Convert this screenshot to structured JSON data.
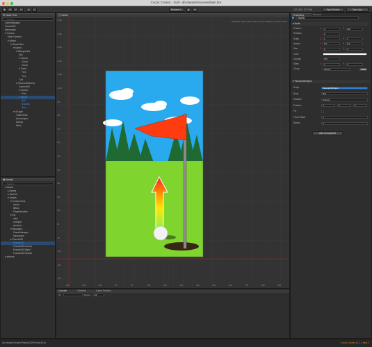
{
  "window": {
    "title": "Cocos Creator - Golf - db://assets/Scenes/Main.fire",
    "status_path": "db://assets/Scripts/Pseudo3D/Pseudo3D.ts",
    "version": "Cocos Creator v2.1.1-beta.2"
  },
  "toolbar": {
    "preview_mode": "Browser",
    "play_glyph": "▶",
    "refresh_glyph": "↻",
    "ip": "192.168.1.52:7456",
    "open_project": "Open Project",
    "open_app": "Open App"
  },
  "scene": {
    "tab": "Scene",
    "hint": "Drag with right mouse button to pan viewport, scroll to zoom"
  },
  "rulers": {
    "x": [
      "-350",
      "-250",
      "-150",
      "-50",
      "50",
      "150",
      "250",
      "350",
      "450",
      "550",
      "650",
      "750",
      "850",
      "950"
    ],
    "y": [
      "1,550",
      "1,450",
      "1,350",
      "1,250",
      "1,150",
      "1,050",
      "950",
      "850",
      "750",
      "650",
      "550",
      "450",
      "350",
      "250",
      "150",
      "50",
      "-50",
      "-150",
      "-250",
      "-350"
    ]
  },
  "hierarchy": {
    "tab": "Node Tree",
    "search": "Search...",
    "rows": [
      {
        "label": "GameManager",
        "d": 1
      },
      {
        "label": "Pseudo3D",
        "d": 1
      },
      {
        "label": "Mechanics",
        "d": 1
      },
      {
        "label": "▾ Canvas",
        "d": 1
      },
      {
        "label": "Main Camera",
        "d": 2
      },
      {
        "label": "▾ Wheel",
        "d": 2
      },
      {
        "label": "▾ GameView",
        "d": 3
      },
      {
        "label": "▾ Scene",
        "d": 4
      },
      {
        "label": "▾ Background",
        "d": 5
      },
      {
        "label": "Sky",
        "d": 6
      },
      {
        "label": "▾ Clouds",
        "d": 6
      },
      {
        "label": "Cloud",
        "d": 7
      },
      {
        "label": "Cloud",
        "d": 7
      },
      {
        "label": "▾ Trees",
        "d": 6
      },
      {
        "label": "Tree",
        "d": 7
      },
      {
        "label": "Tree",
        "d": 7
      },
      {
        "label": "Turf",
        "d": 6
      },
      {
        "label": "▾ Pseudo3DScene",
        "d": 5
      },
      {
        "label": "Camera3D",
        "d": 6
      },
      {
        "label": "▾ Hole3D",
        "d": 6
      },
      {
        "label": "Post",
        "d": 7
      },
      {
        "label": "▾ Ball3D",
        "d": 6,
        "sel": true
      },
      {
        "label": "Ball",
        "d": 7,
        "sel": true
      },
      {
        "label": "Shadow",
        "d": 7,
        "sel": true
      },
      {
        "label": "Sha...",
        "d": 7,
        "sel": true
      },
      {
        "label": "▾ UILayer",
        "d": 4
      },
      {
        "label": "TrailPointer",
        "d": 5
      },
      {
        "label": "ArrowLayer",
        "d": 5
      },
      {
        "label": "Debug",
        "d": 5
      },
      {
        "label": "Wha...",
        "d": 5
      }
    ]
  },
  "assets": {
    "tab": "Assets",
    "search": "Search...",
    "rows": [
      {
        "label": "▾ assets",
        "d": 1
      },
      {
        "label": "▸ Assets",
        "d": 2
      },
      {
        "label": "▸ Scenes",
        "d": 2
      },
      {
        "label": "▾ Scripts",
        "d": 2
      },
      {
        "label": "▾ Components",
        "d": 3
      },
      {
        "label": "Arrow",
        "d": 4
      },
      {
        "label": "Billow",
        "d": 4
      },
      {
        "label": "FlagAnimation",
        "d": 4
      },
      {
        "label": "▾ Etc",
        "d": 3
      },
      {
        "label": "data",
        "d": 4
      },
      {
        "label": "uiHelper",
        "d": 4
      },
      {
        "label": "whatnot",
        "d": 4
      },
      {
        "label": "▾ Managers",
        "d": 3
      },
      {
        "label": "GameManager",
        "d": 4
      },
      {
        "label": "Mechanics",
        "d": 4
      },
      {
        "label": "▾ Pseudo3D",
        "d": 3
      },
      {
        "label": "Pseudo3D",
        "d": 4,
        "sel": true
      },
      {
        "label": "Pseudo3DCamera",
        "d": 4
      },
      {
        "label": "Pseudo3DObject",
        "d": 4
      },
      {
        "label": "Pseudo3DParallax",
        "d": 4
      },
      {
        "label": "▸ internal",
        "d": 1
      }
    ]
  },
  "properties": {
    "tab": "Properties",
    "tab2": "Service",
    "node_name": "Ball3D",
    "node_section": "Node",
    "rows": [
      {
        "label": "Position",
        "a": "0",
        "b": "300"
      },
      {
        "label": "Rotation",
        "a": "0",
        "b": ""
      },
      {
        "label": "Scale",
        "a": "1",
        "b": "1"
      },
      {
        "label": "Anchor",
        "a": "0.5",
        "b": "0.5"
      },
      {
        "label": "Size",
        "a": "0",
        "b": "0"
      },
      {
        "label": "Color",
        "a": "",
        "b": ""
      },
      {
        "label": "Opacity",
        "a": "255",
        "b": ""
      },
      {
        "label": "Skew",
        "a": "0",
        "b": "0"
      },
      {
        "label": "Group",
        "a": "default",
        "b": "Edit"
      }
    ],
    "component": "Pseudo3DObject",
    "crows": [
      {
        "label": "Script",
        "a": "Pseudo3DObject"
      },
      {
        "label": "Body",
        "a": "Ball"
      },
      {
        "label": "Shadow",
        "a": "Shadow"
      },
      {
        "label": "Position",
        "a": "0",
        "b": "0",
        "c": "0"
      },
      {
        "label": "Fix",
        "a": ""
      },
      {
        "label": "Fixed Offset",
        "a": "0"
      },
      {
        "label": "Radius",
        "a": "0"
      }
    ],
    "add_component": "Add Component"
  },
  "console": {
    "tabs": [
      "Console",
      "Timeline",
      "Game Preview"
    ],
    "filter": "All",
    "regex": "Regex"
  },
  "colors": {
    "selection": "#3b8ff0",
    "accent_blue": "#2f7fd8",
    "sky": "#29a9ee",
    "grass": "#7fd52e",
    "flag": "#ff3c10"
  }
}
